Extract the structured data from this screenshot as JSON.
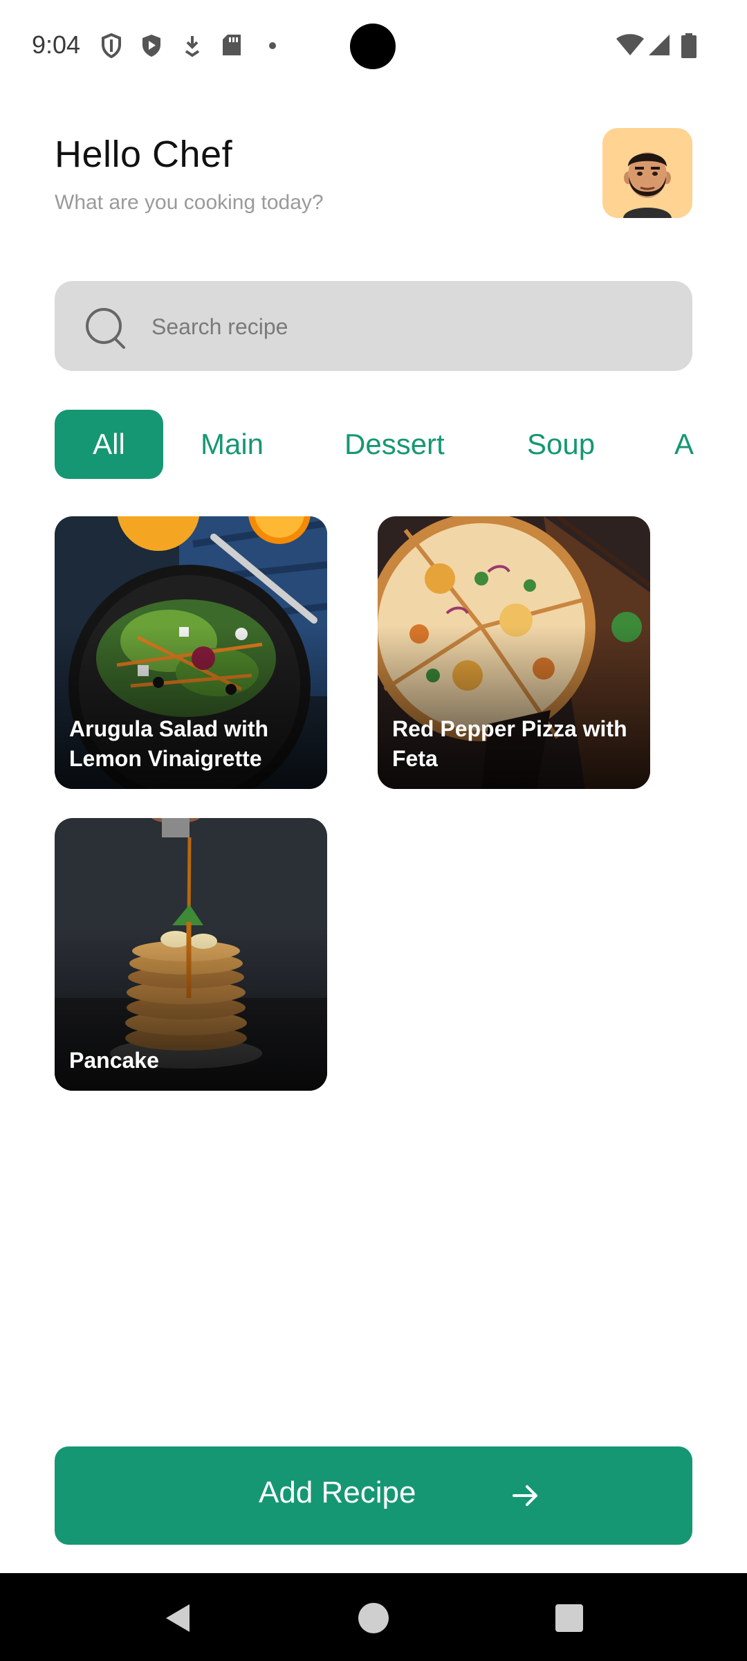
{
  "status_bar": {
    "time": "9:04",
    "icons": [
      "shield-icon",
      "play-shield-icon",
      "download-icon",
      "sd-card-icon",
      "dot-icon"
    ],
    "right_icons": [
      "wifi-icon",
      "signal-icon",
      "battery-icon"
    ]
  },
  "header": {
    "greeting": "Hello Chef",
    "subtitle": "What are you cooking today?",
    "avatar_icon": "memoji-avatar"
  },
  "search": {
    "placeholder": "Search recipe",
    "value": ""
  },
  "categories": [
    {
      "label": "All",
      "active": true
    },
    {
      "label": "Main",
      "active": false
    },
    {
      "label": "Dessert",
      "active": false
    },
    {
      "label": "Soup",
      "active": false
    },
    {
      "label": "A",
      "active": false
    }
  ],
  "recipes": [
    {
      "title": "Arugula Salad with Lemon Vinaigrette"
    },
    {
      "title": "Red Pepper Pizza with Feta"
    },
    {
      "title": "Pancake"
    }
  ],
  "add_button": {
    "label": "Add Recipe",
    "icon": "arrow-right-icon"
  },
  "colors": {
    "accent": "#169773",
    "avatar_bg": "#ffd391",
    "search_bg": "#dadada"
  },
  "nav_bar": {
    "icons": [
      "back-icon",
      "home-icon",
      "recents-icon"
    ]
  }
}
